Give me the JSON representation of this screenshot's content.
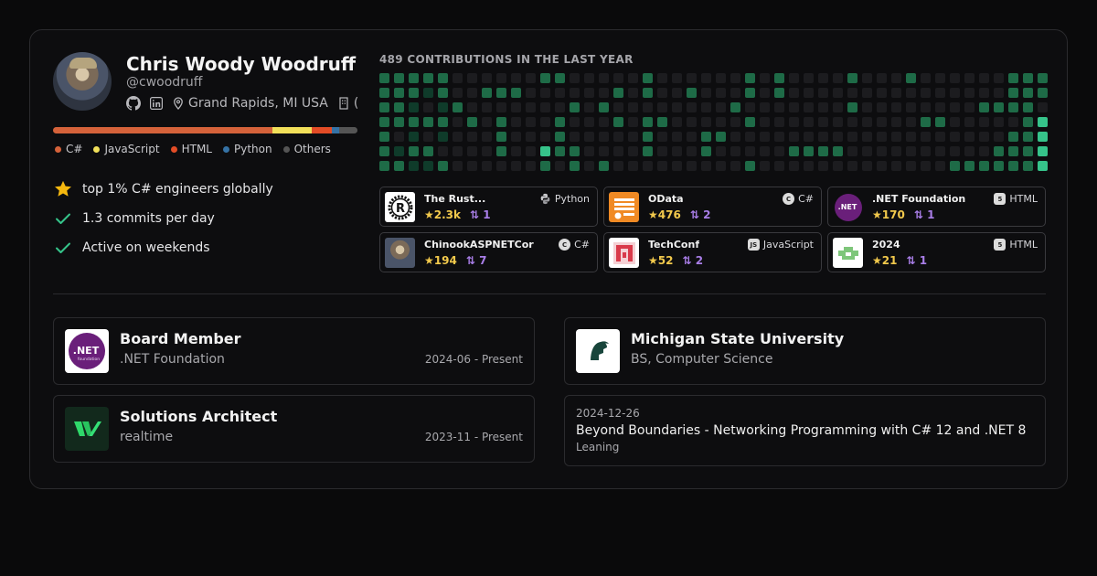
{
  "profile": {
    "name": "Chris Woody Woodruff",
    "handle": "@cwoodruff",
    "location": "Grand Rapids, MI USA",
    "company_truncated": "("
  },
  "languages": [
    {
      "name": "C#",
      "color": "#d5623a",
      "share": 0.72
    },
    {
      "name": "JavaScript",
      "color": "#f1e05a",
      "share": 0.13
    },
    {
      "name": "HTML",
      "color": "#e34c26",
      "share": 0.065
    },
    {
      "name": "Python",
      "color": "#3572a5",
      "share": 0.025
    },
    {
      "name": "Others",
      "color": "#555555",
      "share": 0.06
    }
  ],
  "stats": [
    {
      "icon": "star-icon",
      "text": "top 1% C# engineers globally"
    },
    {
      "icon": "check-icon",
      "text": "1.3 commits per day"
    },
    {
      "icon": "check-icon",
      "text": "Active on weekends"
    }
  ],
  "contributions": {
    "title": "489 CONTRIBUTIONS IN THE LAST YEAR",
    "weeks": 46,
    "levels": [
      [
        2,
        2,
        2,
        2,
        2,
        2,
        2
      ],
      [
        2,
        2,
        2,
        2,
        0,
        1,
        2
      ],
      [
        2,
        2,
        1,
        2,
        1,
        2,
        1
      ],
      [
        2,
        1,
        0,
        2,
        0,
        2,
        1
      ],
      [
        2,
        2,
        1,
        2,
        1,
        0,
        2
      ],
      [
        0,
        0,
        2,
        0,
        0,
        0,
        0
      ],
      [
        0,
        0,
        0,
        2,
        0,
        0,
        0
      ],
      [
        0,
        2,
        0,
        0,
        0,
        0,
        0
      ],
      [
        0,
        2,
        0,
        2,
        2,
        2,
        0
      ],
      [
        0,
        2,
        0,
        0,
        0,
        0,
        0
      ],
      [
        0,
        0,
        0,
        0,
        0,
        0,
        0
      ],
      [
        2,
        0,
        0,
        0,
        0,
        3,
        2
      ],
      [
        2,
        0,
        0,
        2,
        2,
        2,
        0
      ],
      [
        0,
        0,
        2,
        0,
        0,
        2,
        2
      ],
      [
        0,
        0,
        0,
        0,
        0,
        0,
        0
      ],
      [
        0,
        0,
        2,
        0,
        0,
        0,
        2
      ],
      [
        0,
        2,
        0,
        2,
        0,
        0,
        0
      ],
      [
        0,
        0,
        0,
        0,
        0,
        0,
        0
      ],
      [
        2,
        2,
        0,
        2,
        2,
        2,
        0
      ],
      [
        0,
        0,
        0,
        2,
        0,
        0,
        0
      ],
      [
        0,
        0,
        0,
        0,
        0,
        0,
        0
      ],
      [
        0,
        2,
        0,
        0,
        0,
        0,
        0
      ],
      [
        0,
        0,
        0,
        0,
        2,
        2,
        0
      ],
      [
        0,
        0,
        0,
        0,
        2,
        0,
        0
      ],
      [
        0,
        0,
        2,
        0,
        0,
        0,
        0
      ],
      [
        2,
        2,
        0,
        2,
        0,
        0,
        2
      ],
      [
        0,
        0,
        0,
        0,
        0,
        0,
        0
      ],
      [
        2,
        2,
        0,
        0,
        0,
        0,
        0
      ],
      [
        0,
        0,
        0,
        0,
        0,
        2,
        0
      ],
      [
        0,
        0,
        0,
        0,
        0,
        2,
        0
      ],
      [
        0,
        0,
        0,
        0,
        0,
        2,
        0
      ],
      [
        0,
        0,
        0,
        0,
        0,
        2,
        0
      ],
      [
        2,
        0,
        2,
        0,
        0,
        0,
        0
      ],
      [
        0,
        0,
        0,
        0,
        0,
        0,
        0
      ],
      [
        0,
        0,
        0,
        0,
        0,
        0,
        0
      ],
      [
        0,
        0,
        0,
        0,
        0,
        0,
        0
      ],
      [
        2,
        0,
        0,
        0,
        0,
        0,
        0
      ],
      [
        0,
        0,
        0,
        2,
        0,
        0,
        0
      ],
      [
        0,
        0,
        0,
        2,
        0,
        0,
        0
      ],
      [
        0,
        0,
        0,
        0,
        0,
        0,
        2
      ],
      [
        0,
        0,
        0,
        0,
        0,
        0,
        2
      ],
      [
        0,
        0,
        2,
        0,
        0,
        0,
        2
      ],
      [
        0,
        0,
        2,
        0,
        0,
        2,
        2
      ],
      [
        2,
        2,
        2,
        0,
        2,
        2,
        2
      ],
      [
        2,
        2,
        2,
        2,
        2,
        2,
        2
      ],
      [
        2,
        2,
        0,
        3,
        3,
        3,
        3
      ]
    ],
    "colors": [
      "#1c1c1f",
      "#0f3b2a",
      "#1e6b47",
      "#36c38a"
    ]
  },
  "repos": [
    {
      "name": "The Rust...",
      "lang": "Python",
      "lang_icon": "python-icon",
      "stars": "2.3k",
      "prs": "1",
      "logo": "rust-logo"
    },
    {
      "name": "OData",
      "lang": "C#",
      "lang_icon": "csharp-icon",
      "stars": "476",
      "prs": "2",
      "logo": "odata-logo"
    },
    {
      "name": ".NET Foundation",
      "lang": "HTML",
      "lang_icon": "html5-icon",
      "stars": "170",
      "prs": "1",
      "logo": "dotnet-foundation-logo"
    },
    {
      "name": "ChinookASPNETCoreA",
      "lang": "C#",
      "lang_icon": "csharp-icon",
      "stars": "194",
      "prs": "7",
      "logo": "chinook-avatar"
    },
    {
      "name": "TechConf",
      "lang": "JavaScript",
      "lang_icon": "javascript-icon",
      "stars": "52",
      "prs": "2",
      "logo": "techconf-logo"
    },
    {
      "name": "2024",
      "lang": "HTML",
      "lang_icon": "html5-icon",
      "stars": "21",
      "prs": "1",
      "logo": "pixel-logo"
    }
  ],
  "experience": [
    {
      "title": "Board Member",
      "org": ".NET Foundation",
      "date": "2024-06 - Present",
      "logo": "dotnet-foundation-logo"
    },
    {
      "title": "Solutions Architect",
      "org": "realtime",
      "date": "2023-11 - Present",
      "logo": "realtime-logo"
    }
  ],
  "education": {
    "title": "Michigan State University",
    "degree": "BS, Computer Science",
    "logo": "spartan-logo"
  },
  "talk": {
    "date": "2024-12-26",
    "title": "Beyond Boundaries - Networking Programming with C# 12 and .NET 8",
    "subtitle": "Leaning"
  },
  "ui": {
    "star": "★",
    "pr": "⇅",
    "net_text": ".NET",
    "net_sub": "foundation"
  }
}
